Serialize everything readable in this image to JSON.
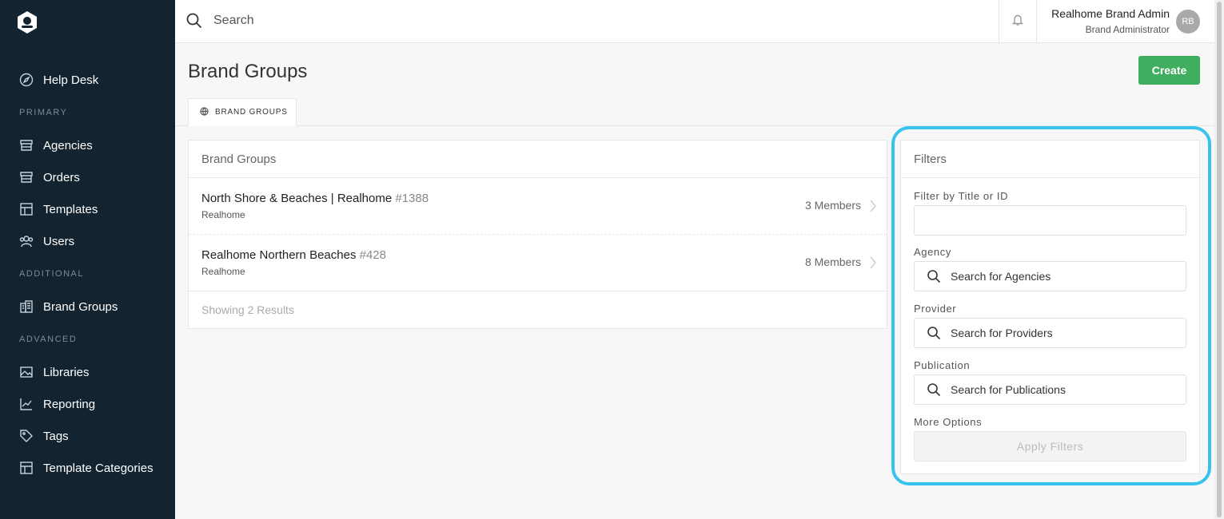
{
  "sidebar": {
    "items": [
      {
        "label": "Help Desk",
        "icon": "compass-icon"
      },
      {
        "label": "Agencies",
        "icon": "storefront-icon"
      },
      {
        "label": "Orders",
        "icon": "storefront-icon"
      },
      {
        "label": "Templates",
        "icon": "grid-icon"
      },
      {
        "label": "Users",
        "icon": "users-icon"
      },
      {
        "label": "Brand Groups",
        "icon": "buildings-icon"
      },
      {
        "label": "Libraries",
        "icon": "image-icon"
      },
      {
        "label": "Reporting",
        "icon": "line-chart-icon"
      },
      {
        "label": "Tags",
        "icon": "tag-icon"
      },
      {
        "label": "Template Categories",
        "icon": "grid-icon"
      }
    ],
    "sections": {
      "primary": "PRIMARY",
      "additional": "ADDITIONAL",
      "advanced": "ADVANCED"
    }
  },
  "topbar": {
    "search_placeholder": "Search",
    "user_name": "Realhome Brand Admin",
    "user_role": "Brand Administrator",
    "avatar_initials": "RB"
  },
  "page": {
    "title": "Brand Groups",
    "create_label": "Create",
    "tab_label": "BRAND GROUPS"
  },
  "list": {
    "header": "Brand Groups",
    "rows": [
      {
        "title": "North Shore & Beaches | Realhome",
        "id": "#1388",
        "subtitle": "Realhome",
        "members": "3 Members"
      },
      {
        "title": "Realhome Northern Beaches",
        "id": "#428",
        "subtitle": "Realhome",
        "members": "8 Members"
      }
    ],
    "results": "Showing 2 Results"
  },
  "filters": {
    "header": "Filters",
    "title_label": "Filter by Title or ID",
    "title_value": "",
    "agency_label": "Agency",
    "agency_placeholder": "Search for Agencies",
    "provider_label": "Provider",
    "provider_placeholder": "Search for Providers",
    "publication_label": "Publication",
    "publication_placeholder": "Search for Publications",
    "more_options_label": "More Options",
    "apply_label": "Apply Filters"
  },
  "colors": {
    "sidebar_bg": "#13232f",
    "create_button": "#3fae5e",
    "highlight": "#39c2ee"
  }
}
